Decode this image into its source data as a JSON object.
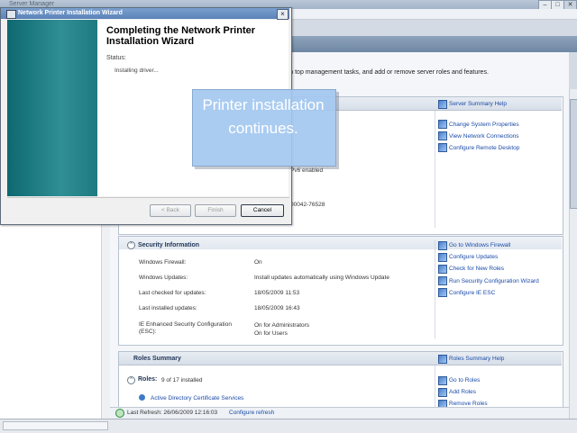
{
  "server_manager": {
    "title": "Server Manager",
    "intro_text": "rm top management tasks, and add or remove server roles and features.",
    "server_summary": {
      "help_link": "Server Summary Help",
      "tasks": [
        "Change System Properties",
        "View Network Connections",
        "Configure Remote Desktop"
      ],
      "partial_values": [
        "Pv6 enabled",
        "00042-76528"
      ]
    },
    "security": {
      "title": "Security Information",
      "rows": [
        {
          "label": "Windows Firewall:",
          "value": "On"
        },
        {
          "label": "Windows Updates:",
          "value": "Install updates automatically using Windows Update"
        },
        {
          "label": "Last checked for updates:",
          "value": "18/05/2009 11:53"
        },
        {
          "label": "Last installed updates:",
          "value": "18/05/2009 16:43"
        },
        {
          "label": "IE Enhanced Security Configuration (ESC):",
          "value": "On for Administrators\nOn for Users"
        }
      ],
      "tasks": [
        "Go to Windows Firewall",
        "Configure Updates",
        "Check for New Roles",
        "Run Security Configuration Wizard",
        "Configure IE ESC"
      ]
    },
    "roles_summary": {
      "title": "Roles Summary",
      "help_link": "Roles Summary Help",
      "roles_label": "Roles:",
      "roles_count": "9 of 17 installed",
      "first_role": "Active Directory Certificate Services",
      "tasks": [
        "Go to Roles",
        "Add Roles",
        "Remove Roles"
      ]
    },
    "status_bar": {
      "last_refresh": "Last Refresh: 26/06/2009 12:16:03",
      "configure_refresh": "Configure refresh"
    }
  },
  "wizard": {
    "title": "Network Printer Installation Wizard",
    "heading": "Completing the Network Printer Installation Wizard",
    "status_label": "Status:",
    "status_value": "Installing driver...",
    "buttons": {
      "back": "< Back",
      "finish": "Finish",
      "cancel": "Cancel"
    }
  },
  "callout": {
    "text": "Printer installation continues."
  }
}
